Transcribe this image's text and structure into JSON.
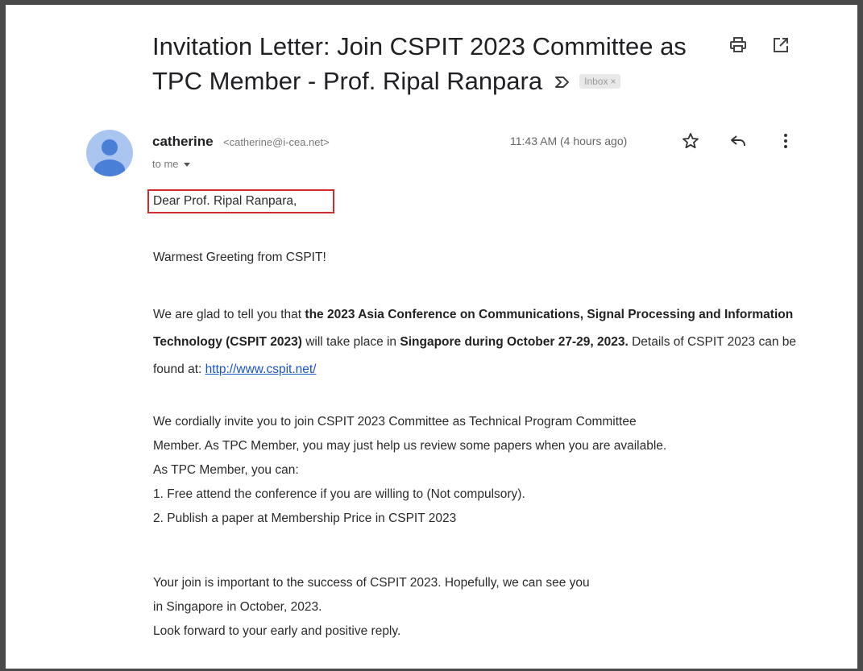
{
  "email": {
    "subject": "Invitation Letter: Join CSPIT 2023 Committee as TPC Member - Prof. Ripal Ranpara",
    "label_chip": "Inbox",
    "sender_name": "catherine",
    "sender_email": "<catherine@i-cea.net>",
    "recipient": "to me",
    "timestamp": "11:43 AM (4 hours ago)",
    "icons": {
      "print": "print-icon",
      "open_new_window": "open-in-new-window-icon",
      "important": "important-marker-icon",
      "star": "star-icon",
      "reply": "reply-icon",
      "more": "more-options-icon",
      "avatar": "avatar-person-icon"
    },
    "colors": {
      "highlight_box": "#d22b2b",
      "link": "#1a55c7",
      "avatar_bg": "#aac6f0",
      "avatar_fg": "#4a7fd8"
    }
  },
  "body": {
    "greeting": "Dear Prof. Ripal Ranpara,",
    "warm_greeting": "Warmest Greeting from CSPIT!",
    "p1_a": "We are glad to tell you that ",
    "p1_b": "the 2023 Asia Conference on Communications, Signal Processing and Information Technology (CSPIT 2023)",
    "p1_c": " will take place in ",
    "p1_d": "Singapore during October 27-29, 2023.",
    "p1_e": "  Details of CSPIT 2023 can be found at: ",
    "p1_link": "http://www.cspit.net/",
    "p2_line1": "We cordially invite you to join CSPIT 2023 Committee as Technical Program Committee",
    "p2_line2": "Member. As TPC Member, you may just help us review some papers when you are available.",
    "p2_line3": "As TPC Member, you can:",
    "p2_item1": "1. Free attend the conference if you are willing to (Not compulsory).",
    "p2_item2": "2. Publish a paper at Membership Price in CSPIT 2023",
    "p3_line1": "Your join is important to the success of CSPIT 2023. Hopefully, we can see you",
    "p3_line2": "in Singapore in October, 2023.",
    "p3_line3": "Look forward to your early and positive reply."
  }
}
